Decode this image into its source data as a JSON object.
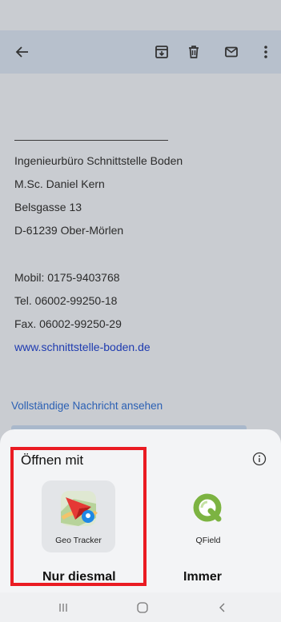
{
  "toolbar": {
    "back_icon": "arrow-left-icon",
    "archive_icon": "archive-icon",
    "delete_icon": "trash-icon",
    "mail_icon": "mail-icon",
    "more_icon": "more-vertical-icon"
  },
  "email": {
    "signature": [
      "Ingenieurbüro Schnittstelle Boden",
      "M.Sc. Daniel Kern",
      "Belsgasse 13",
      "D-61239 Ober-Mörlen",
      "",
      "Mobil: 0175-9403768",
      "Tel.  06002-99250-18",
      "Fax. 06002-99250-29"
    ],
    "website": "www.schnittstelle-boden.de",
    "full_message_link": "Vollständige Nachricht ansehen"
  },
  "open_with_sheet": {
    "title": "Öffnen mit",
    "apps": [
      {
        "label": "Geo Tracker",
        "icon": "geo-tracker-icon"
      },
      {
        "label": "QField",
        "icon": "qfield-icon"
      }
    ],
    "just_once_label": "Nur diesmal",
    "always_label": "Immer"
  },
  "colors": {
    "highlight": "#ea1b22",
    "link": "#1e3bb0"
  }
}
